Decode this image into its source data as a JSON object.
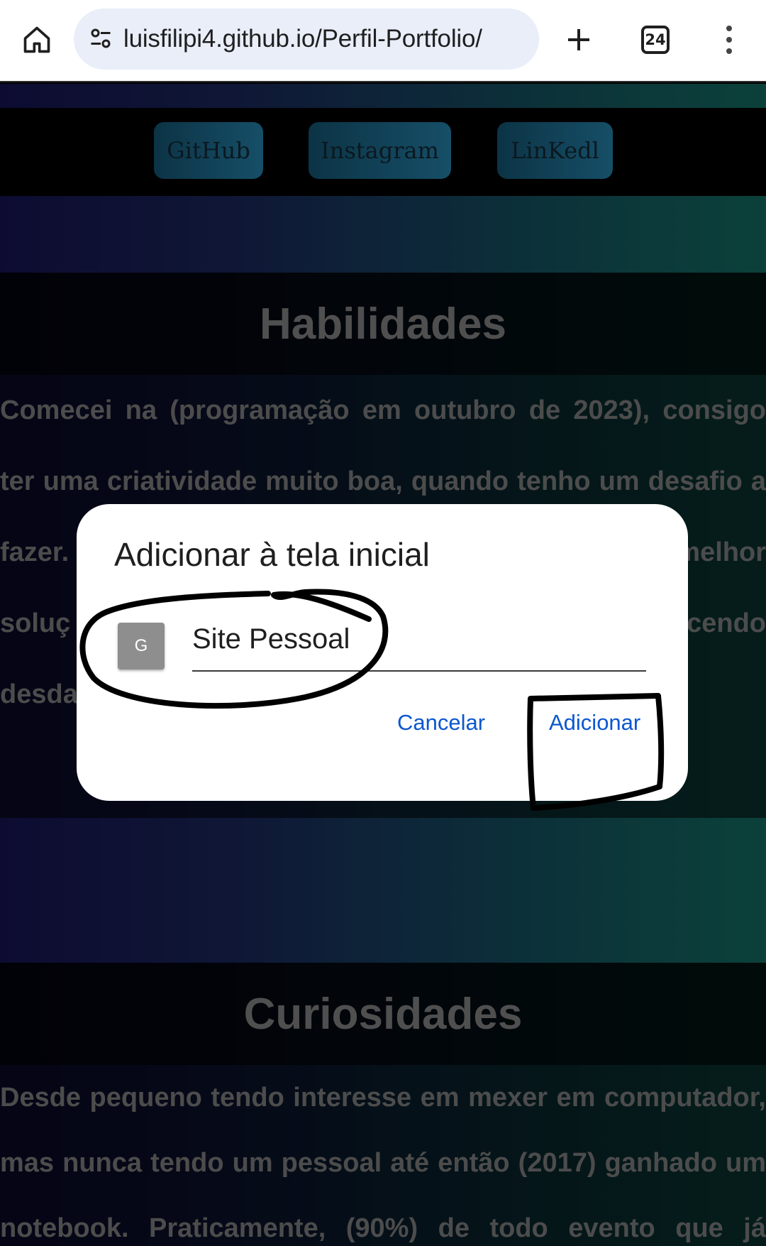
{
  "browser": {
    "url": "luisfilipi4.github.io/Perfil-Portfolio/",
    "tab_count": "24"
  },
  "page": {
    "social_links": [
      "GitHub",
      "Instagram",
      "LinKedl"
    ],
    "habilidades": {
      "title": "Habilidades",
      "lines": [
        "Comecei na (programação em outubro de 2023), consigo",
        "ter uma criatividade muito boa, quando tenho um desafio a",
        "fazer.",
        "soluç",
        "desda"
      ],
      "line3_right": "melhor",
      "line4_right": "cendo"
    },
    "curiosidades": {
      "title": "Curiosidades",
      "lines": [
        "Desde pequeno tendo interesse em mexer em computador,",
        "mas nunca tendo um pessoal até então (2017) ganhado um",
        "notebook. Praticamente, (90%) de todo evento que já"
      ]
    }
  },
  "dialog": {
    "title": "Adicionar à tela inicial",
    "icon_letter": "G",
    "name_value": "Site Pessoal",
    "cancel_label": "Cancelar",
    "add_label": "Adicionar"
  },
  "colors": {
    "accent": "#0b57d0",
    "annotation": "#000000"
  },
  "icons": [
    "home-icon",
    "site-settings-icon",
    "plus-icon",
    "tab-switcher-icon",
    "more-vert-icon"
  ]
}
